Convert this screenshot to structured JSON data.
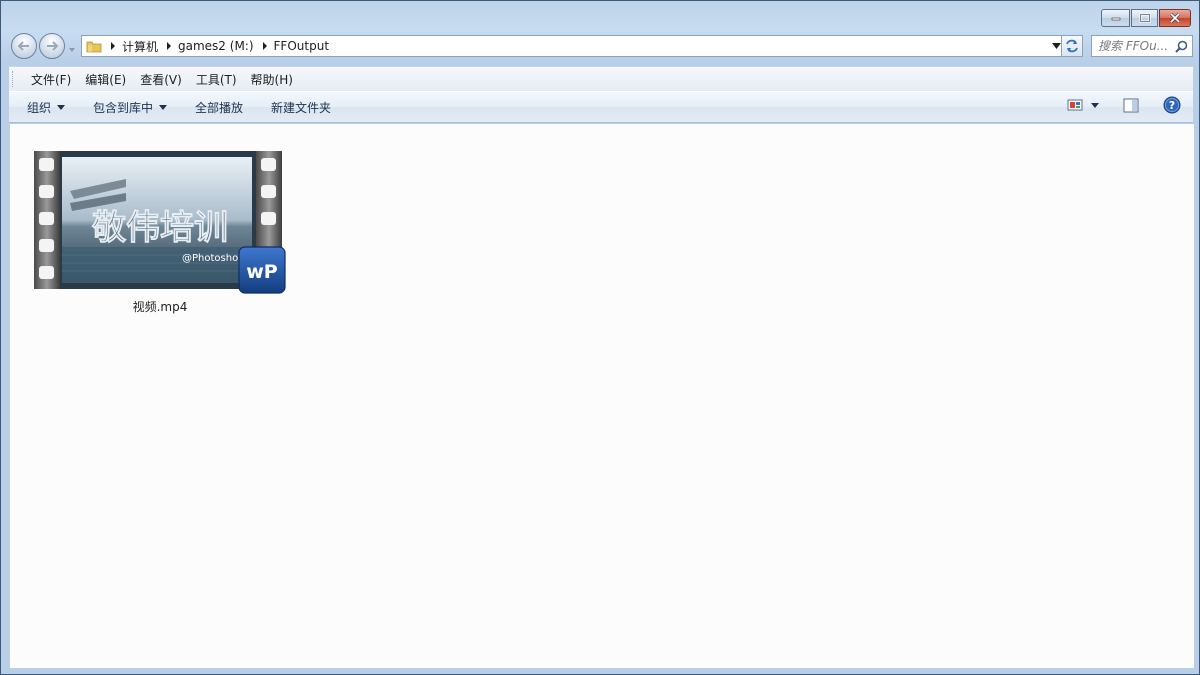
{
  "window": {
    "controls": {
      "minimize_icon": "minimize-icon",
      "maximize_icon": "restore-icon",
      "close_icon": "close-icon"
    }
  },
  "address_bar": {
    "breadcrumbs": [
      "计算机",
      "games2 (M:)",
      "FFOutput"
    ],
    "search_placeholder": "搜索 FFOu..."
  },
  "menu": {
    "items": [
      "文件(F)",
      "编辑(E)",
      "查看(V)",
      "工具(T)",
      "帮助(H)"
    ]
  },
  "command_bar": {
    "organize": "组织",
    "include_in_library": "包含到库中",
    "play_all": "全部播放",
    "new_folder": "新建文件夹"
  },
  "files": [
    {
      "name": "视频.mp4",
      "thumbnail_text": "敬伟培训",
      "thumbnail_caption": "@Photoshop",
      "badge_text": "wP"
    }
  ],
  "colors": {
    "close_red": "#c5432b",
    "badge_blue": "#1d4f9e"
  }
}
